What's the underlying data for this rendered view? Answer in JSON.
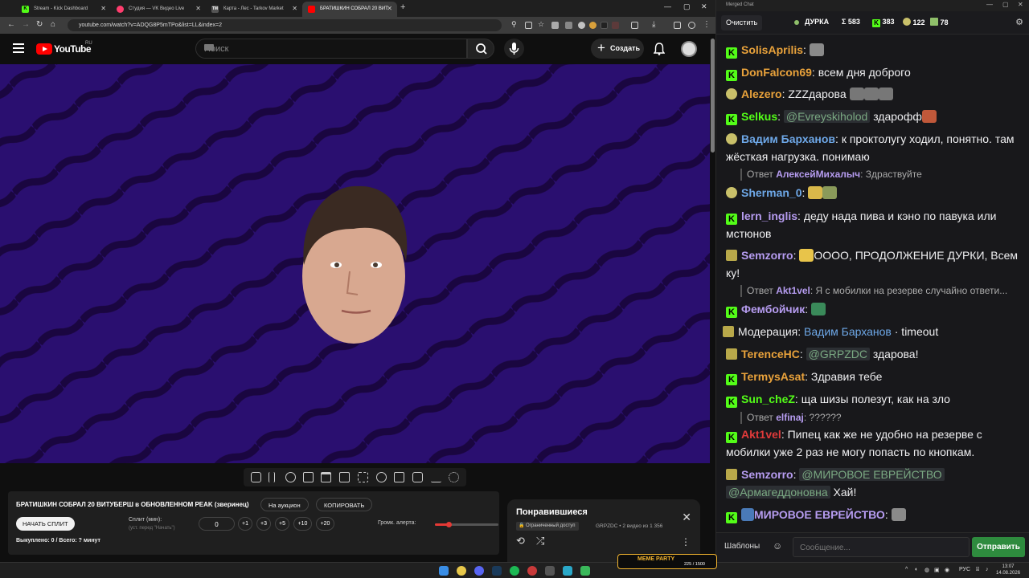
{
  "browser": {
    "tabs": [
      {
        "title": "Stream - Kick Dashboard",
        "favicon_color": "#53fc18",
        "favicon": "K"
      },
      {
        "title": "Студия — VK Видео Live",
        "favicon_color": "#ff3d6e",
        "favicon": ""
      },
      {
        "title": "Карта - Лес - Tarkov Market",
        "favicon_color": "#888888",
        "favicon": "TM"
      },
      {
        "title": "БРАТИШКИН СОБРАЛ 20 ВИТ",
        "favicon_color": "#ff0000",
        "favicon": ""
      }
    ],
    "new_tab": "+",
    "url": "youtube.com/watch?v=ADQG8P5mTPo&list=LL&index=2"
  },
  "youtube": {
    "logo_text": "YouTube",
    "region": "RU",
    "search_placeholder": "Поиск",
    "create_label": "Создать"
  },
  "panel": {
    "title": "БРАТИШКИН СОБРАЛ 20 ВИТУБЕРШ в ОБНОВЛЕННОМ PEAK (зверинец)",
    "auction_btn": "На аукцион",
    "copy_btn": "КОПИРОВАТЬ",
    "split_btn": "НАЧАТЬ СПЛИТ",
    "split_label": "Сплит (мин):",
    "split_hint": "(уст. перед \"Начать\")",
    "split_value": "0",
    "plus_buttons": [
      "+1",
      "+3",
      "+5",
      "+10",
      "+20"
    ],
    "volume_label": "Громк. алерта:",
    "volume_level": 0.22,
    "bought": "Выкуплено: 0 / Всего: ? минут"
  },
  "liked": {
    "title": "Понравившиеся",
    "restricted": "Ограниченный доступ",
    "meta": "GRPZDC • 2 видео из 1 356"
  },
  "chat": {
    "window_title": "Merged Chat",
    "clear_btn": "Очистить",
    "channel": "ДУРКА",
    "stats": {
      "total": "Σ 583",
      "kick": "383",
      "vk": "122",
      "other": "78"
    },
    "messages": [
      {
        "user": "SolisAprilis",
        "color": "#e9a23b",
        "badge": "kick",
        "text": ""
      },
      {
        "user": "DonFalcon69",
        "color": "#e9a23b",
        "badge": "kick",
        "text": "всем дня доброго"
      },
      {
        "user": "Alezero",
        "color": "#e9a23b",
        "badge": "plat",
        "text": "ZZZдарова"
      },
      {
        "user": "Selkus",
        "color": "#53fc18",
        "badge": "kick",
        "mention": "@Evreyskiholod",
        "text": "здарофф"
      },
      {
        "user": "Вадим Барханов",
        "color": "#6ea8e8",
        "badge": "plat",
        "text": "к проктолугу ходил, понятно. там жёсткая нагрузка. понимаю"
      },
      {
        "user": "Sherman_0",
        "color": "#6ea8e8",
        "badge": "plat",
        "text": ""
      },
      {
        "user": "lern_inglis",
        "color": "#b69cf0",
        "badge": "kick",
        "text": "деду нада пива и кэно по павука или мстюнов"
      },
      {
        "user": "Semzorro",
        "color": "#b69cf0",
        "badge": "plat",
        "text": "ОООО, ПРОДОЛЖЕНИЕ ДУРКИ, Всем ку!"
      },
      {
        "user": "Фембойчик",
        "color": "#b69cf0",
        "badge": "kick",
        "text": ""
      },
      {
        "user": "TerenceHC",
        "color": "#e9a23b",
        "badge": "plat",
        "mention": "@GRPZDC",
        "text": "здарова!"
      },
      {
        "user": "TermysAsat",
        "color": "#e9a23b",
        "badge": "kick",
        "text": "Здравия тебе"
      },
      {
        "user": "Sun_cheZ",
        "color": "#53fc18",
        "badge": "kick",
        "text": "ща шизы полезут, как на зло"
      },
      {
        "user": "Akt1vel",
        "color": "#e03a3a",
        "badge": "kick",
        "text": "Пипец как же не удобно на резерве с мобилки уже 2 раз не могу попасть по кнопкам."
      },
      {
        "user": "Semzorro",
        "color": "#b69cf0",
        "badge": "plat",
        "mention": "@МИРОВОЕ ЕВРЕЙСТВО",
        "mention2": "@Армагеддоновна",
        "text": "Хай!"
      },
      {
        "user": "МИРОВОЕ ЕВРЕЙСТВО",
        "color": "#b69cf0",
        "badge": "kick",
        "text": ""
      }
    ],
    "replies": [
      {
        "prefix": "Ответ",
        "user": "АлексейМихалыч",
        "text": ": Здраствуйте"
      },
      {
        "prefix": "Ответ",
        "user": "Akt1vel",
        "text": ": Я с мобилки на резерве случайно ответи..."
      },
      {
        "prefix": "Ответ",
        "user": "elfinaj",
        "text": ": ??????"
      }
    ],
    "moderation": {
      "label": "Модерация:",
      "user": "Вадим Барханов",
      "action": "· timeout"
    },
    "templates_btn": "Шаблоны",
    "input_placeholder": "Сообщение...",
    "send_btn": "Отправить"
  },
  "taskbar": {
    "lang": "РУС",
    "time": "13:07",
    "date": "14.08.2026",
    "overlay_title": "MEME PARTY",
    "overlay_progress": "225 / 1500"
  },
  "icons": {
    "toolbar": [
      "loop-icon",
      "sort-icon",
      "cast-icon",
      "screenshot-icon",
      "playlist-icon",
      "pip-icon",
      "subtitles-icon",
      "speed-icon",
      "aspect-icon",
      "camera-icon",
      "lab-icon",
      "settings-icon"
    ]
  }
}
